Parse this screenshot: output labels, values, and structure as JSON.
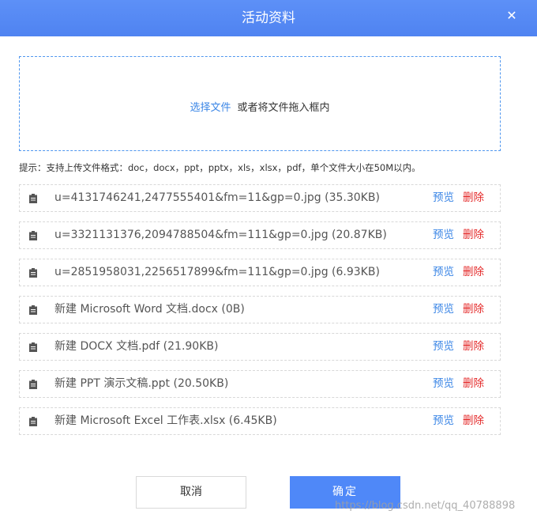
{
  "dialog": {
    "title": "活动资料",
    "close_glyph": "✕"
  },
  "upload": {
    "select_label": "选择文件",
    "drag_text": "或者将文件拖入框内"
  },
  "hint": "提示：支持上传文件格式：doc，docx，ppt，pptx，xls，xlsx，pdf，单个文件大小在50M以内。",
  "files": [
    {
      "name": "u=4131746241,2477555401&fm=11&gp=0.jpg (35.30KB)",
      "preview": "预览",
      "delete": "删除"
    },
    {
      "name": "u=3321131376,2094788504&fm=111&gp=0.jpg (20.87KB)",
      "preview": "预览",
      "delete": "删除"
    },
    {
      "name": "u=2851958031,2256517899&fm=111&gp=0.jpg (6.93KB)",
      "preview": "预览",
      "delete": "删除"
    },
    {
      "name": "新建 Microsoft Word 文档.docx (0B)",
      "preview": "预览",
      "delete": "删除"
    },
    {
      "name": "新建 DOCX 文档.pdf (21.90KB)",
      "preview": "预览",
      "delete": "删除"
    },
    {
      "name": "新建 PPT 演示文稿.ppt (20.50KB)",
      "preview": "预览",
      "delete": "删除"
    },
    {
      "name": "新建 Microsoft Excel 工作表.xlsx (6.45KB)",
      "preview": "预览",
      "delete": "删除"
    }
  ],
  "buttons": {
    "cancel": "取消",
    "confirm": "确定"
  },
  "watermark": "https://blog.csdn.net/qq_40788898",
  "colors": {
    "header": "#5b8ff9",
    "link": "#3b86e6",
    "delete": "#e42a2a",
    "confirm": "#4f88f8"
  },
  "icons": {
    "file": "clipboard-icon",
    "close": "close-icon"
  }
}
